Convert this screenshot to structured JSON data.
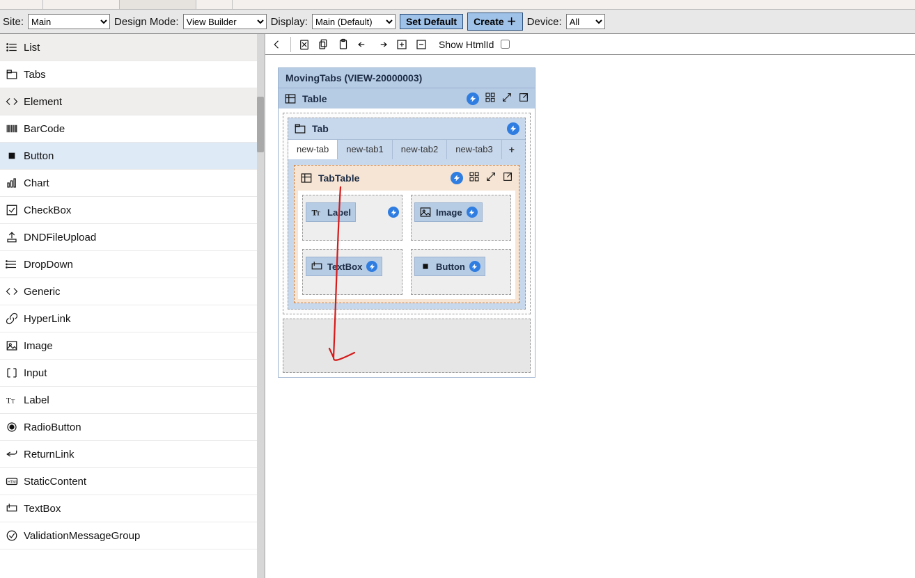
{
  "toolbar": {
    "site_label": "Site:",
    "site_value": "Main",
    "mode_label": "Design Mode:",
    "mode_value": "View Builder",
    "display_label": "Display:",
    "display_value": "Main (Default)",
    "set_default": "Set Default",
    "create": "Create",
    "device_label": "Device:",
    "device_value": "All"
  },
  "canvasToolbar": {
    "show_htmlid": "Show HtmlId"
  },
  "sidebar": {
    "items": [
      {
        "label": "List",
        "icon": "list",
        "heading": true
      },
      {
        "label": "Tabs",
        "icon": "tab",
        "heading": false
      },
      {
        "label": "Element",
        "icon": "code",
        "heading": true
      },
      {
        "label": "BarCode",
        "icon": "barcode",
        "heading": false
      },
      {
        "label": "Button",
        "icon": "button",
        "heading": false,
        "selected": true
      },
      {
        "label": "Chart",
        "icon": "chart",
        "heading": false
      },
      {
        "label": "CheckBox",
        "icon": "checkbox",
        "heading": false
      },
      {
        "label": "DNDFileUpload",
        "icon": "upload",
        "heading": false
      },
      {
        "label": "DropDown",
        "icon": "dropdown",
        "heading": false
      },
      {
        "label": "Generic",
        "icon": "code",
        "heading": false
      },
      {
        "label": "HyperLink",
        "icon": "link",
        "heading": false
      },
      {
        "label": "Image",
        "icon": "image",
        "heading": false
      },
      {
        "label": "Input",
        "icon": "input",
        "heading": false
      },
      {
        "label": "Label",
        "icon": "label",
        "heading": false
      },
      {
        "label": "RadioButton",
        "icon": "radio",
        "heading": false
      },
      {
        "label": "ReturnLink",
        "icon": "return",
        "heading": false
      },
      {
        "label": "StaticContent",
        "icon": "html",
        "heading": false
      },
      {
        "label": "TextBox",
        "icon": "textbox",
        "heading": false
      },
      {
        "label": "ValidationMessageGroup",
        "icon": "check",
        "heading": false
      }
    ]
  },
  "canvas": {
    "view_title": "MovingTabs (VIEW-20000003)",
    "table_label": "Table",
    "tab_label": "Tab",
    "tabs": [
      "new-tab",
      "new-tab1",
      "new-tab2",
      "new-tab3"
    ],
    "tabtable_label": "TabTable",
    "cells": {
      "label": "Label",
      "image": "Image",
      "textbox": "TextBox",
      "button": "Button"
    }
  }
}
